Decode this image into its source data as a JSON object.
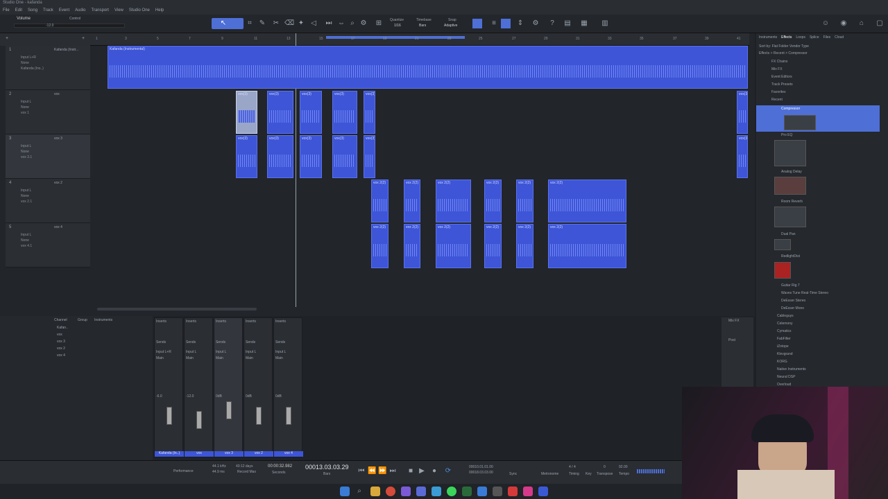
{
  "titlebar": {
    "title": "Studio One - kafanda"
  },
  "menu": [
    "File",
    "Edit",
    "Song",
    "Track",
    "Event",
    "Audio",
    "Transport",
    "View",
    "Studio One",
    "Help"
  ],
  "toolbar": {
    "volume_label": "Volume",
    "control_label": "Control",
    "volume_value": "-12.0",
    "quantize_label": "Quantize",
    "quantize_value": "1/16",
    "timebase_label": "Timebase",
    "timebase_value": "Bars",
    "snap_label": "Snap",
    "snap_value": "Adaptive"
  },
  "ruler": [
    "1",
    "3",
    "5",
    "7",
    "9",
    "11",
    "13",
    "15",
    "17",
    "19",
    "21",
    "23",
    "25",
    "27",
    "29",
    "31",
    "33",
    "35",
    "37",
    "39",
    "41"
  ],
  "tracks": [
    {
      "num": "1",
      "name": "Kafanda (Instr...",
      "rows": [
        "Input L+R",
        "None",
        "Kafanda (Ins..)"
      ]
    },
    {
      "num": "2",
      "name": "vox",
      "rows": [
        "Input L",
        "None",
        "vox 1"
      ]
    },
    {
      "num": "3",
      "name": "vox 3",
      "rows": [
        "Input L",
        "None",
        "vox 3.1"
      ]
    },
    {
      "num": "4",
      "name": "vox 2",
      "rows": [
        "Input L",
        "None",
        "vox 2.1"
      ]
    },
    {
      "num": "5",
      "name": "vox 4",
      "rows": [
        "Input L",
        "None",
        "vox 4.1"
      ]
    }
  ],
  "clips": {
    "main": "Kafanda (Instrumental)",
    "vox": "vox(3)",
    "vox2": "vox 2(2)"
  },
  "browser": {
    "tabs": [
      "Instruments",
      "Effects",
      "Loops",
      "Splice",
      "Files",
      "Cloud"
    ],
    "sort": "Sort by:  Flat  Folder  Vendor  Type",
    "path": "Effects > Recent > Compressor",
    "items": [
      "FX Chains",
      "Mix FX",
      "Event Editors",
      "Track Presets",
      "Favorites",
      "Recent",
      "Compressor",
      "Pro EQ",
      "Analog Delay",
      "Room Reverb",
      "Dual Pan",
      "RedlightDist",
      "Guitar Rig 7",
      "Waves Tune Real-Time Stereo",
      "DeEsser Stereo",
      "DeEsser Mono",
      "Cableguys",
      "Celemony",
      "Cymatics",
      "FabFilter",
      "iZotope",
      "Klevgrand",
      "KORG",
      "Native Instruments",
      "Neural DSP",
      "Overloud"
    ]
  },
  "mixer": {
    "channel_tabs": [
      "Channel",
      "Group",
      "Instruments"
    ],
    "channel_list": [
      "Kafan..",
      "vox",
      "vox 3",
      "vox 2",
      "vox 4"
    ],
    "channels": [
      {
        "input": "Input L+R",
        "out": "Main",
        "db": "-6.0",
        "name": "Kafanda (In..)"
      },
      {
        "input": "Input L",
        "out": "Main",
        "db": "-12.0",
        "name": "vox"
      },
      {
        "input": "Input L",
        "out": "Main",
        "db": "0dB",
        "name": "vox 3"
      },
      {
        "input": "Input L",
        "out": "Main",
        "db": "0dB",
        "name": "vox 2"
      },
      {
        "input": "Input L",
        "out": "Main",
        "db": "0dB",
        "name": "vox 4"
      }
    ],
    "inserts": "Inserts",
    "sends": "Sends",
    "mix_fx": "Mix FX",
    "post": "Post"
  },
  "transport": {
    "sample_rate": "44.1 kHz",
    "latency": "44.9 ms",
    "record_max": "43:12 days",
    "time": "00:00:32.982",
    "bars": "00013.03.03.29",
    "loop_start": "00010.01.01.00",
    "loop_end": "00018.03.03.00",
    "sig": "4 / 4",
    "key": "0",
    "tempo": "92.00",
    "perf_label": "Performance",
    "record_label": "Record Max",
    "seconds_label": "Seconds",
    "bars_label": "Bars",
    "sync_label": "Sync",
    "metronome_label": "Metronome",
    "timing_label": "Timing",
    "key_label": "Key",
    "transpose_label": "Transpose",
    "tempo_label": "Tempo"
  }
}
